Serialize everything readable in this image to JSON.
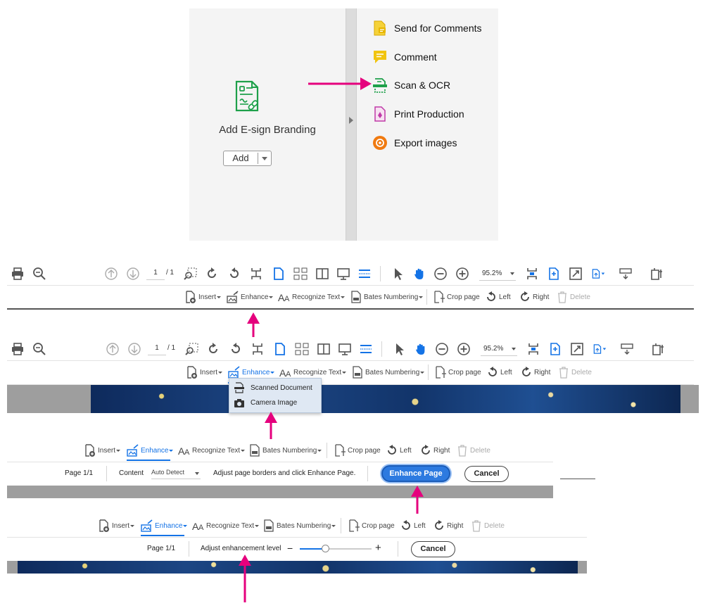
{
  "tools_panel": {
    "esign_title": "Add E-sign Branding",
    "add_label": "Add",
    "items": [
      {
        "label": "Send for Comments",
        "icon": "send-for-comments-icon",
        "color": "#e8b600"
      },
      {
        "label": "Comment",
        "icon": "comment-icon",
        "color": "#e8b600"
      },
      {
        "label": "Scan & OCR",
        "icon": "scan-ocr-icon",
        "color": "#1ea04a"
      },
      {
        "label": "Print Production",
        "icon": "print-production-icon",
        "color": "#c03aa8"
      },
      {
        "label": "Export images",
        "icon": "export-images-icon",
        "color": "#f07a10"
      }
    ]
  },
  "main_toolbar": {
    "page_current": "1",
    "page_total": "/ 1",
    "zoom": "95.2%"
  },
  "secondary_toolbar": {
    "insert": "Insert",
    "enhance": "Enhance",
    "recognize_text": "Recognize Text",
    "bates_numbering": "Bates Numbering",
    "crop_page": "Crop page",
    "left": "Left",
    "right": "Right",
    "delete": "Delete"
  },
  "enhance_menu": {
    "scanned_document": "Scanned Document",
    "camera_image": "Camera Image"
  },
  "enhance_bar": {
    "page": "Page 1/1",
    "content_label": "Content",
    "content_value": "Auto Detect",
    "instruction": "Adjust page borders and click Enhance Page.",
    "enhance_button": "Enhance Page",
    "cancel_button": "Cancel"
  },
  "level_bar": {
    "page": "Page 1/1",
    "label": "Adjust enhancement level",
    "minus": "−",
    "plus": "+",
    "level": 0.35,
    "cancel_button": "Cancel"
  },
  "colors": {
    "accent": "#1473e6",
    "arrow": "#e5007d"
  }
}
